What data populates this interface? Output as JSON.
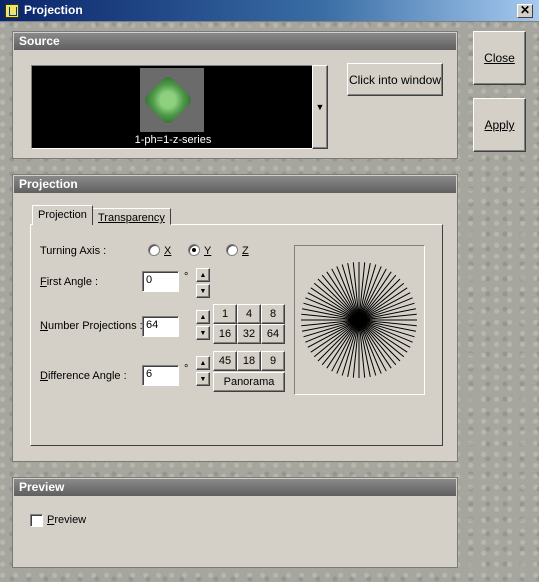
{
  "window": {
    "title": "Projection",
    "close_glyph": "✕"
  },
  "source": {
    "heading": "Source",
    "thumbnail_caption": "1-ph=1-z-series",
    "click_button": "Click into window"
  },
  "side_buttons": {
    "close": "Close",
    "apply": "Apply"
  },
  "projection": {
    "heading": "Projection",
    "tabs": [
      {
        "label": "Projection"
      },
      {
        "label": "Transparency"
      }
    ],
    "turning_axis": {
      "label": "Turning Axis :",
      "options": [
        "X",
        "Y",
        "Z"
      ],
      "selected": "Y"
    },
    "first_angle": {
      "label": "First Angle :",
      "value": "0",
      "unit": "°"
    },
    "number_projections": {
      "label": "Number Projections :",
      "value": "64",
      "presets": [
        "1",
        "4",
        "8",
        "16",
        "32",
        "64"
      ]
    },
    "difference_angle": {
      "label": "Difference Angle :",
      "value": "6",
      "unit": "°",
      "presets": [
        "45",
        "18",
        "9"
      ],
      "panorama": "Panorama"
    },
    "preview_ray_count": 64
  },
  "preview": {
    "heading": "Preview",
    "checkbox_label": "Preview",
    "checked": false
  },
  "colors": {
    "panel_header": "#6f6f6f",
    "face": "#d4d0c8",
    "title_bar": "#0a246a",
    "thumb_green": "#4f9a4a"
  }
}
